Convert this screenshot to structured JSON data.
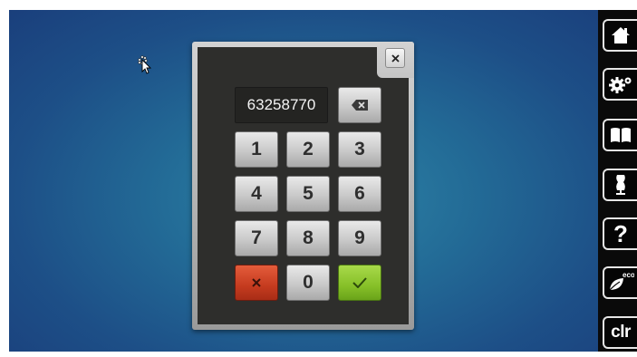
{
  "keypad": {
    "display_value": "63258770",
    "keys": [
      "1",
      "2",
      "3",
      "4",
      "5",
      "6",
      "7",
      "8",
      "9",
      "0"
    ]
  },
  "sidebar": {
    "clr_label": "clr",
    "help_label": "?",
    "eco_label": "eco",
    "icons": [
      "home-icon",
      "settings-icon",
      "book-icon",
      "dress-form-icon",
      "help-icon",
      "eco-icon",
      "clr"
    ]
  },
  "colors": {
    "background": "#236c97",
    "cancel": "#c53b1f",
    "confirm": "#86c028",
    "panel": "#2e2e2c"
  }
}
